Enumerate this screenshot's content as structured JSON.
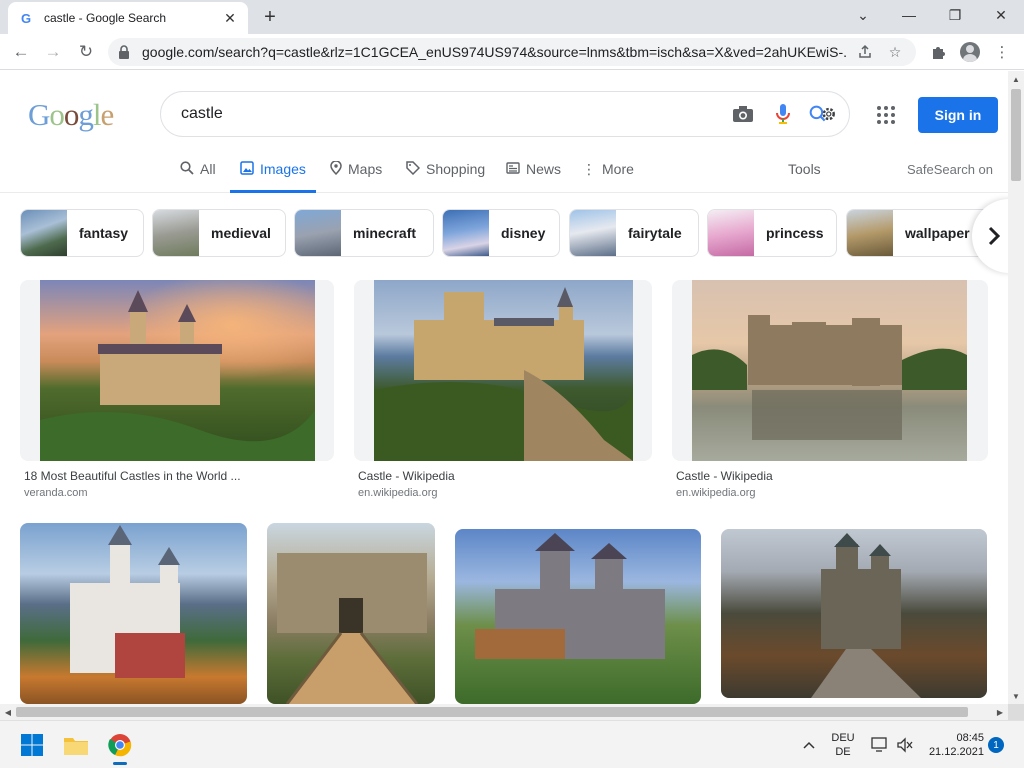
{
  "browser": {
    "tab_title": "castle - Google Search",
    "tab_favicon": "G",
    "url": "google.com/search?q=castle&rlz=1C1GCEA_enUS974US974&source=lnms&tbm=isch&sa=X&ved=2ahUKEwiS-..."
  },
  "google": {
    "logo_letters": [
      "G",
      "o",
      "o",
      "g",
      "l",
      "e"
    ],
    "query": "castle",
    "signin_label": "Sign in",
    "nav": {
      "all": "All",
      "images": "Images",
      "maps": "Maps",
      "shopping": "Shopping",
      "news": "News",
      "more": "More",
      "tools": "Tools",
      "safesearch": "SafeSearch on"
    },
    "chips": [
      {
        "label": "fantasy"
      },
      {
        "label": "medieval"
      },
      {
        "label": "minecraft"
      },
      {
        "label": "disney"
      },
      {
        "label": "fairytale"
      },
      {
        "label": "princess"
      },
      {
        "label": "wallpaper"
      }
    ],
    "results": [
      {
        "title": "18 Most Beautiful Castles in the World ...",
        "source": "veranda.com"
      },
      {
        "title": "Castle - Wikipedia",
        "source": "en.wikipedia.org"
      },
      {
        "title": "Castle - Wikipedia",
        "source": "en.wikipedia.org"
      },
      {
        "title": "",
        "source": ""
      },
      {
        "title": "",
        "source": ""
      },
      {
        "title": "",
        "source": ""
      },
      {
        "title": "",
        "source": ""
      }
    ]
  },
  "taskbar": {
    "lang_line1": "DEU",
    "lang_line2": "DE",
    "time": "08:45",
    "date": "21.12.2021",
    "notification_count": "1"
  },
  "colors": {
    "accent": "#1a73e8",
    "chrome_frame": "#dee1e6"
  }
}
